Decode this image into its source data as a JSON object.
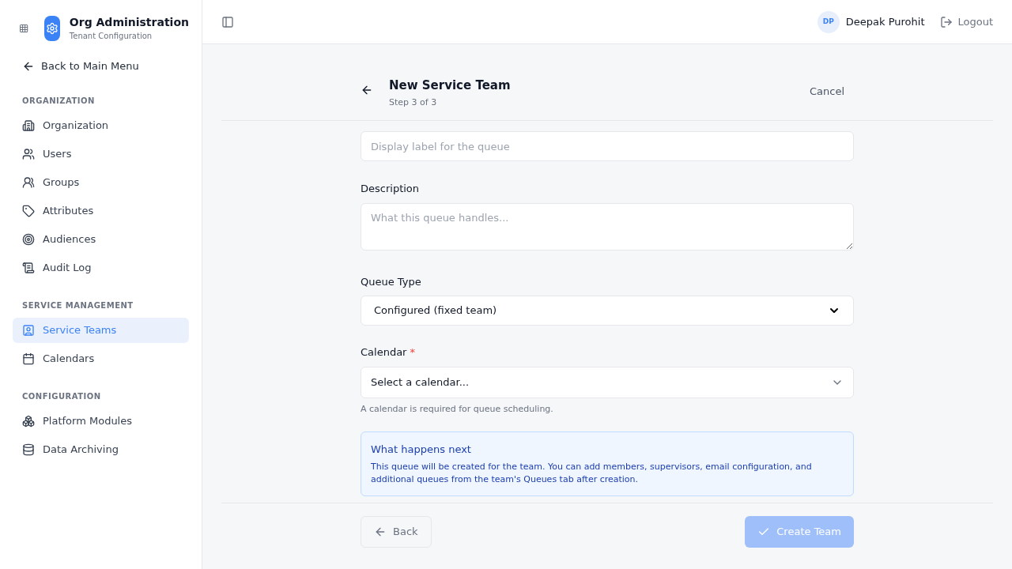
{
  "app": {
    "title": "Org Administration",
    "subtitle": "Tenant Configuration"
  },
  "back_link": "Back to Main Menu",
  "sidebar": {
    "sections": [
      {
        "heading": "ORGANIZATION",
        "items": [
          {
            "label": "Organization",
            "selected": false
          },
          {
            "label": "Users",
            "selected": false
          },
          {
            "label": "Groups",
            "selected": false
          },
          {
            "label": "Attributes",
            "selected": false
          },
          {
            "label": "Audiences",
            "selected": false
          },
          {
            "label": "Audit Log",
            "selected": false
          }
        ]
      },
      {
        "heading": "SERVICE MANAGEMENT",
        "items": [
          {
            "label": "Service Teams",
            "selected": true
          },
          {
            "label": "Calendars",
            "selected": false
          }
        ]
      },
      {
        "heading": "CONFIGURATION",
        "items": [
          {
            "label": "Platform Modules",
            "selected": false
          },
          {
            "label": "Data Archiving",
            "selected": false
          }
        ]
      }
    ]
  },
  "user": {
    "initials": "DP",
    "name": "Deepak Purohit",
    "logout": "Logout"
  },
  "page": {
    "title": "New Service Team",
    "step": "Step 3 of 3",
    "cancel": "Cancel"
  },
  "form": {
    "queue_label": {
      "placeholder": "Display label for the queue"
    },
    "description": {
      "label": "Description",
      "placeholder": "What this queue handles..."
    },
    "queue_type": {
      "label": "Queue Type",
      "value": "Configured (fixed team)"
    },
    "calendar": {
      "label": "Calendar",
      "required_mark": "*",
      "value": "Select a calendar...",
      "hint": "A calendar is required for queue scheduling."
    }
  },
  "info": {
    "title": "What happens next",
    "text": "This queue will be created for the team. You can add members, supervisors, email configuration, and additional queues from the team's Queues tab after creation."
  },
  "footer": {
    "back": "Back",
    "create": "Create Team",
    "create_disabled": true
  }
}
